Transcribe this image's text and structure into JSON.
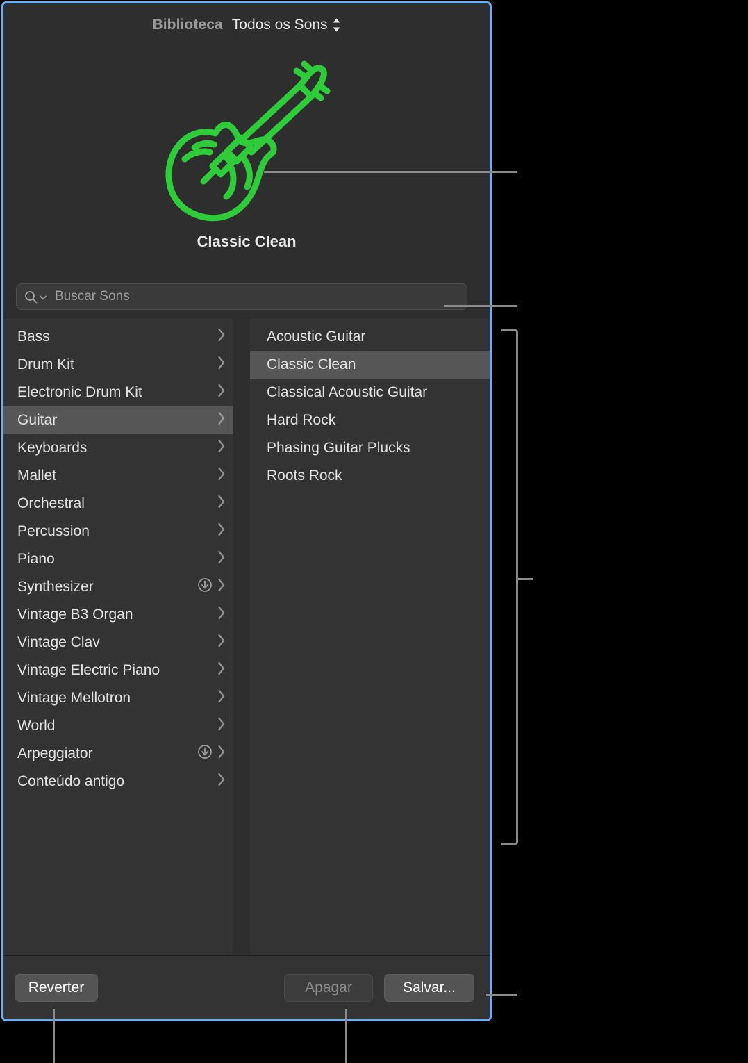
{
  "panel": {
    "header": {
      "library_label": "Biblioteca",
      "sound_set": "Todos os Sons",
      "stepper_icon": "chevron-up-down-icon"
    },
    "hero": {
      "patch_icon": "electric-guitar-icon",
      "patch_icon_color": "#2fcc3a",
      "patch_name": "Classic Clean"
    },
    "search": {
      "icon": "search-icon",
      "chevron_icon": "chevron-down-icon",
      "placeholder": "Buscar Sons",
      "value": ""
    },
    "categories": [
      {
        "label": "Bass",
        "selected": false,
        "download": false
      },
      {
        "label": "Drum Kit",
        "selected": false,
        "download": false
      },
      {
        "label": "Electronic Drum Kit",
        "selected": false,
        "download": false
      },
      {
        "label": "Guitar",
        "selected": true,
        "download": false
      },
      {
        "label": "Keyboards",
        "selected": false,
        "download": false
      },
      {
        "label": "Mallet",
        "selected": false,
        "download": false
      },
      {
        "label": "Orchestral",
        "selected": false,
        "download": false
      },
      {
        "label": "Percussion",
        "selected": false,
        "download": false
      },
      {
        "label": "Piano",
        "selected": false,
        "download": false
      },
      {
        "label": "Synthesizer",
        "selected": false,
        "download": true
      },
      {
        "label": "Vintage B3 Organ",
        "selected": false,
        "download": false
      },
      {
        "label": "Vintage Clav",
        "selected": false,
        "download": false
      },
      {
        "label": "Vintage Electric Piano",
        "selected": false,
        "download": false
      },
      {
        "label": "Vintage Mellotron",
        "selected": false,
        "download": false
      },
      {
        "label": "World",
        "selected": false,
        "download": false
      },
      {
        "label": "Arpeggiator",
        "selected": false,
        "download": true
      },
      {
        "label": "Conteúdo antigo",
        "selected": false,
        "download": false
      }
    ],
    "patches": [
      {
        "label": "Acoustic Guitar",
        "selected": false
      },
      {
        "label": "Classic Clean",
        "selected": true
      },
      {
        "label": "Classical Acoustic Guitar",
        "selected": false
      },
      {
        "label": "Hard Rock",
        "selected": false
      },
      {
        "label": "Phasing Guitar Plucks",
        "selected": false
      },
      {
        "label": "Roots Rock",
        "selected": false
      }
    ],
    "footer": {
      "revert_label": "Reverter",
      "delete_label": "Apagar",
      "save_label": "Salvar..."
    },
    "colors": {
      "selection_blue": "#6aaef7",
      "panel_background": "#2e2e2e",
      "list_background": "#333333",
      "row_selected": "#565656",
      "callout_line": "#8c8c8c"
    }
  }
}
